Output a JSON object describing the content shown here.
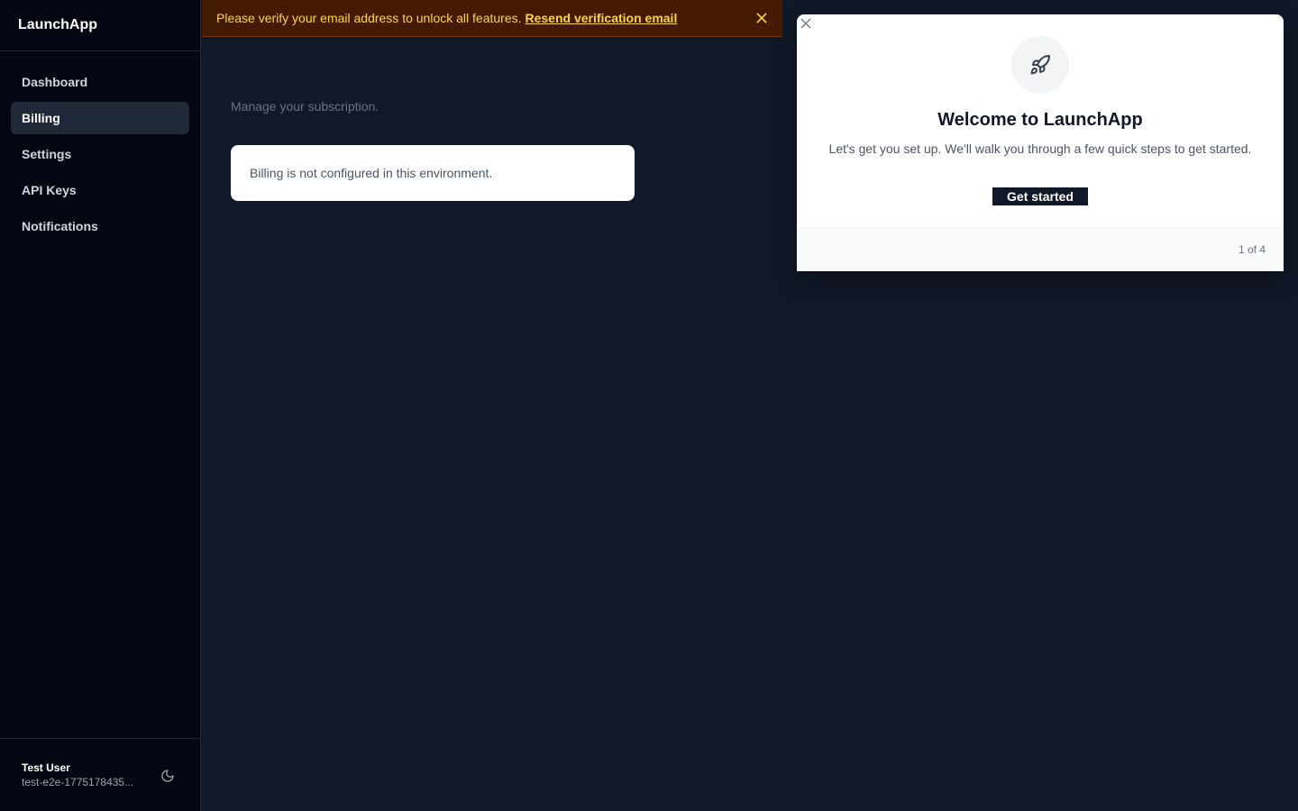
{
  "sidebar": {
    "brand": "LaunchApp",
    "items": [
      {
        "label": "Dashboard",
        "active": false
      },
      {
        "label": "Billing",
        "active": true
      },
      {
        "label": "Settings",
        "active": false
      },
      {
        "label": "API Keys",
        "active": false
      },
      {
        "label": "Notifications",
        "active": false
      }
    ],
    "user": {
      "name": "Test User",
      "email": "test-e2e-1775178435..."
    },
    "theme_icon": "moon-icon"
  },
  "banner": {
    "message": "Please verify your email address to unlock all features.",
    "link_label": "Resend verification email",
    "close_icon": "close-icon"
  },
  "main": {
    "subtitle": "Manage your subscription.",
    "notice": "Billing is not configured in this environment."
  },
  "welcome": {
    "icon": "rocket-icon",
    "title": "Welcome to LaunchApp",
    "description": "Let's get you set up. We'll walk you through a few quick steps to get started.",
    "cta_label": "Get started",
    "step_label": "1 of 4"
  },
  "colors": {
    "background": "#111827",
    "sidebar": "#030712",
    "banner_bg": "#451a03",
    "banner_text": "#fcd34d",
    "primary_button": "#111827"
  }
}
